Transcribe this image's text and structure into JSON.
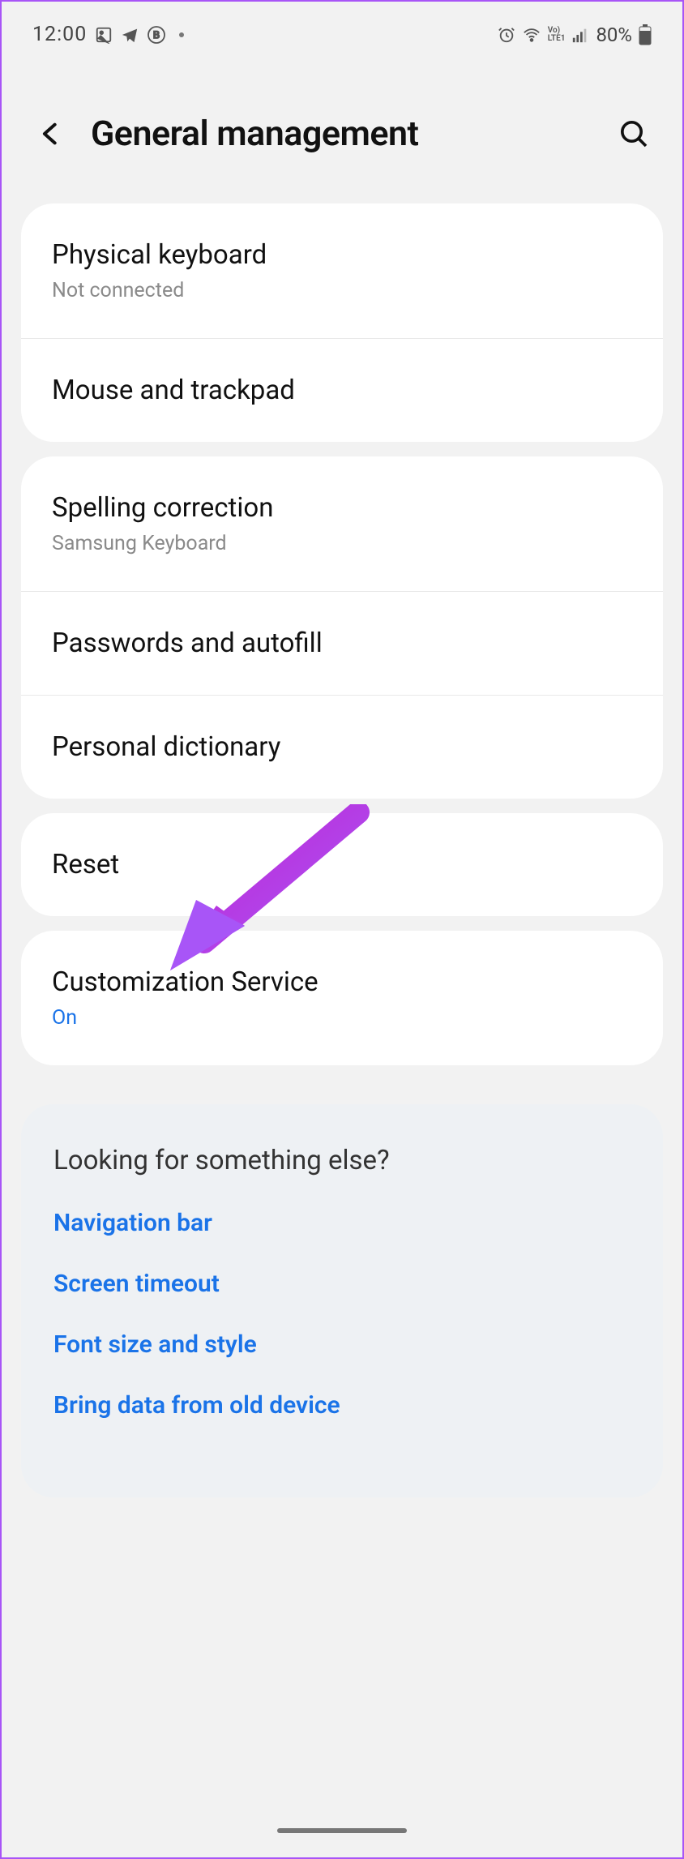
{
  "status": {
    "time": "12:00",
    "battery": "80%"
  },
  "header": {
    "title": "General management"
  },
  "group1": {
    "physical_keyboard": {
      "title": "Physical keyboard",
      "sub": "Not connected"
    },
    "mouse_trackpad": {
      "title": "Mouse and trackpad"
    }
  },
  "group2": {
    "spelling": {
      "title": "Spelling correction",
      "sub": "Samsung Keyboard"
    },
    "passwords": {
      "title": "Passwords and autofill"
    },
    "dictionary": {
      "title": "Personal dictionary"
    }
  },
  "group3": {
    "reset": {
      "title": "Reset"
    }
  },
  "group4": {
    "customization": {
      "title": "Customization Service",
      "sub": "On"
    }
  },
  "footer": {
    "title": "Looking for something else?",
    "links": {
      "nav": "Navigation bar",
      "timeout": "Screen timeout",
      "font": "Font size and style",
      "bring": "Bring data from old device"
    }
  }
}
